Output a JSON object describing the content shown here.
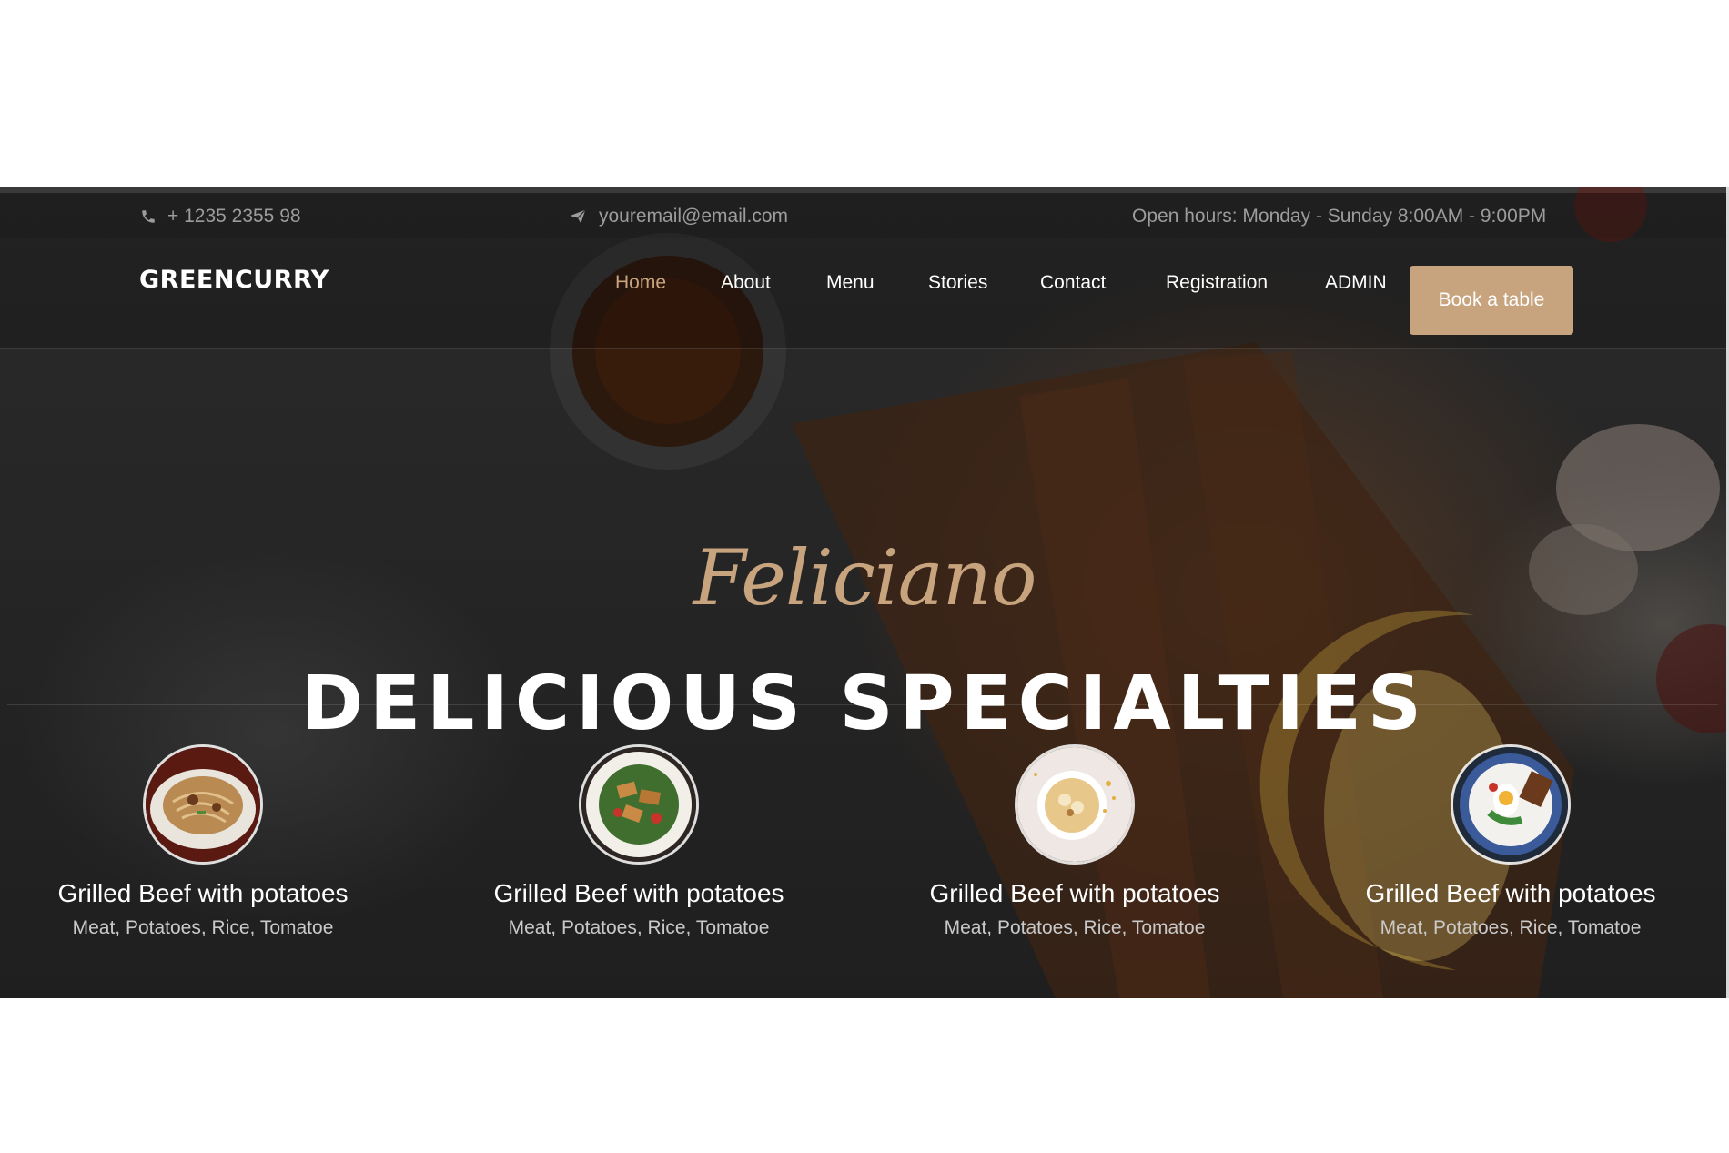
{
  "topbar": {
    "phone": "+ 1235 2355 98",
    "email": "youremail@email.com",
    "hours": "Open hours: Monday - Sunday 8:00AM - 9:00PM"
  },
  "navbar": {
    "brand": "GREENCURRY",
    "links": [
      "Home",
      "About",
      "Menu",
      "Stories",
      "Contact",
      "Registration",
      "ADMIN"
    ],
    "active": "Home",
    "cta": "Book a table"
  },
  "hero": {
    "script": "Feliciano",
    "title": "DELICIOUS SPECIALTIES"
  },
  "dishes": [
    {
      "name": "Grilled Beef with potatoes",
      "ingredients": "Meat, Potatoes, Rice, Tomatoe",
      "image": "noodle-dish"
    },
    {
      "name": "Grilled Beef with potatoes",
      "ingredients": "Meat, Potatoes, Rice, Tomatoe",
      "image": "grilled-salad"
    },
    {
      "name": "Grilled Beef with potatoes",
      "ingredients": "Meat, Potatoes, Rice, Tomatoe",
      "image": "porridge-bowl"
    },
    {
      "name": "Grilled Beef with potatoes",
      "ingredients": "Meat, Potatoes, Rice, Tomatoe",
      "image": "egg-salad"
    }
  ],
  "colors": {
    "accent": "#c8a47e",
    "overlay": "#262626",
    "text": "#ffffff"
  }
}
